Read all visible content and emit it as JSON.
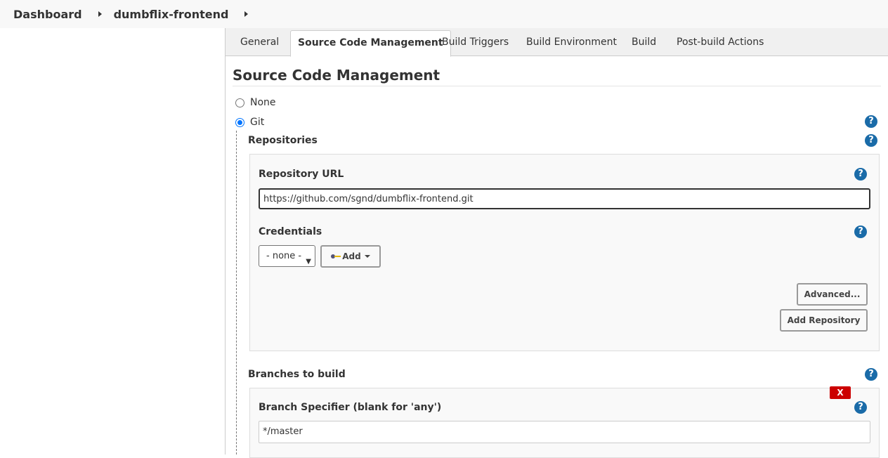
{
  "breadcrumb": {
    "items": [
      "Dashboard",
      "dumbflix-frontend"
    ]
  },
  "tabs": [
    {
      "label": "General",
      "active": false
    },
    {
      "label": "Source Code Management",
      "active": true
    },
    {
      "label": "Build Triggers",
      "active": false
    },
    {
      "label": "Build Environment",
      "active": false
    },
    {
      "label": "Build",
      "active": false
    },
    {
      "label": "Post-build Actions",
      "active": false
    }
  ],
  "scm": {
    "title": "Source Code Management",
    "options": [
      {
        "label": "None",
        "checked": false
      },
      {
        "label": "Git",
        "checked": true
      }
    ],
    "repositories_label": "Repositories",
    "repository": {
      "url_label": "Repository URL",
      "url_value": "https://github.com/sgnd/dumbflix-frontend.git",
      "credentials_label": "Credentials",
      "credentials_selected": "- none -",
      "add_label": "Add",
      "advanced_label": "Advanced...",
      "add_repository_label": "Add Repository"
    },
    "branches": {
      "label": "Branches to build",
      "delete_label": "X",
      "specifier_label": "Branch Specifier (blank for 'any')",
      "specifier_value": "*/master"
    }
  },
  "help_glyph": "?",
  "colors": {
    "help_icon": "#1a6ba8",
    "radio_accent": "#0075ff",
    "delete_button": "#cc0000"
  }
}
